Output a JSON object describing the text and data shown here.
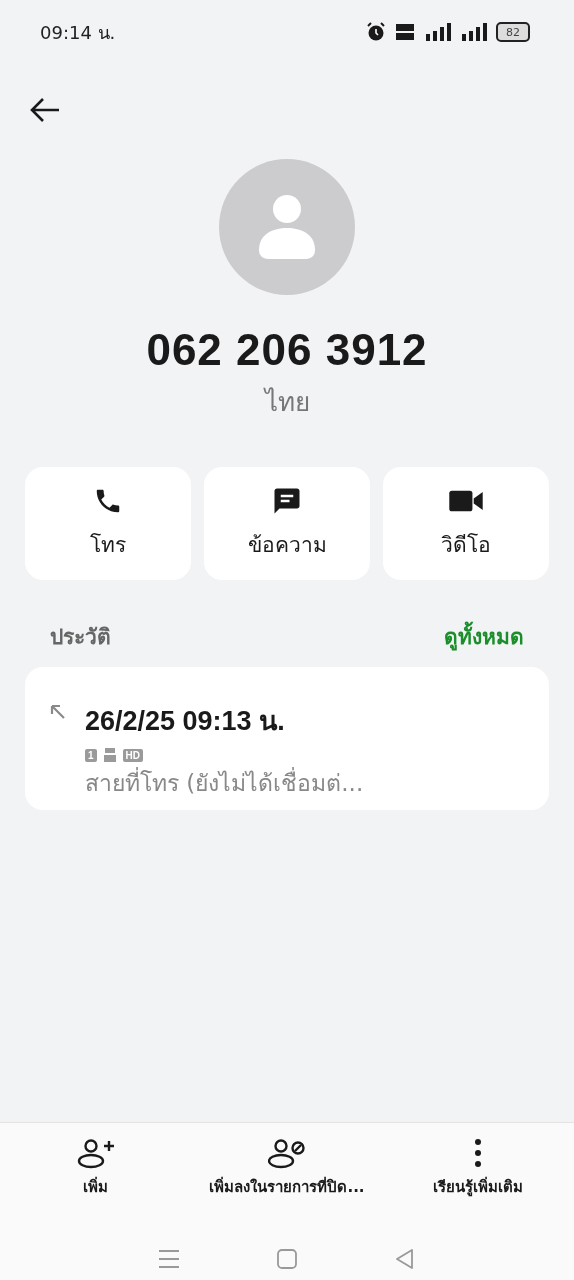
{
  "status_bar": {
    "time": "09:14 น.",
    "battery": "82"
  },
  "contact": {
    "number": "062 206 3912",
    "location": "ไทย"
  },
  "actions": [
    {
      "kind": "call",
      "label": "โทร"
    },
    {
      "kind": "message",
      "label": "ข้อความ"
    },
    {
      "kind": "video",
      "label": "วิดีโอ"
    }
  ],
  "history": {
    "title": "ประวัติ",
    "view_all": "ดูทั้งหมด",
    "entries": [
      {
        "datetime": "26/2/25 09:13 น.",
        "sim": "1",
        "hd": "HD",
        "status": "สายที่โทร (ยังไม่ได้เชื่อมต่..."
      }
    ]
  },
  "bottom_actions": [
    {
      "kind": "add",
      "label": "เพิ่ม"
    },
    {
      "kind": "block",
      "label": "เพิ่มลงในรายการที่ปิด..."
    },
    {
      "kind": "more",
      "label": "เรียนรู้เพิ่มเติม"
    }
  ]
}
